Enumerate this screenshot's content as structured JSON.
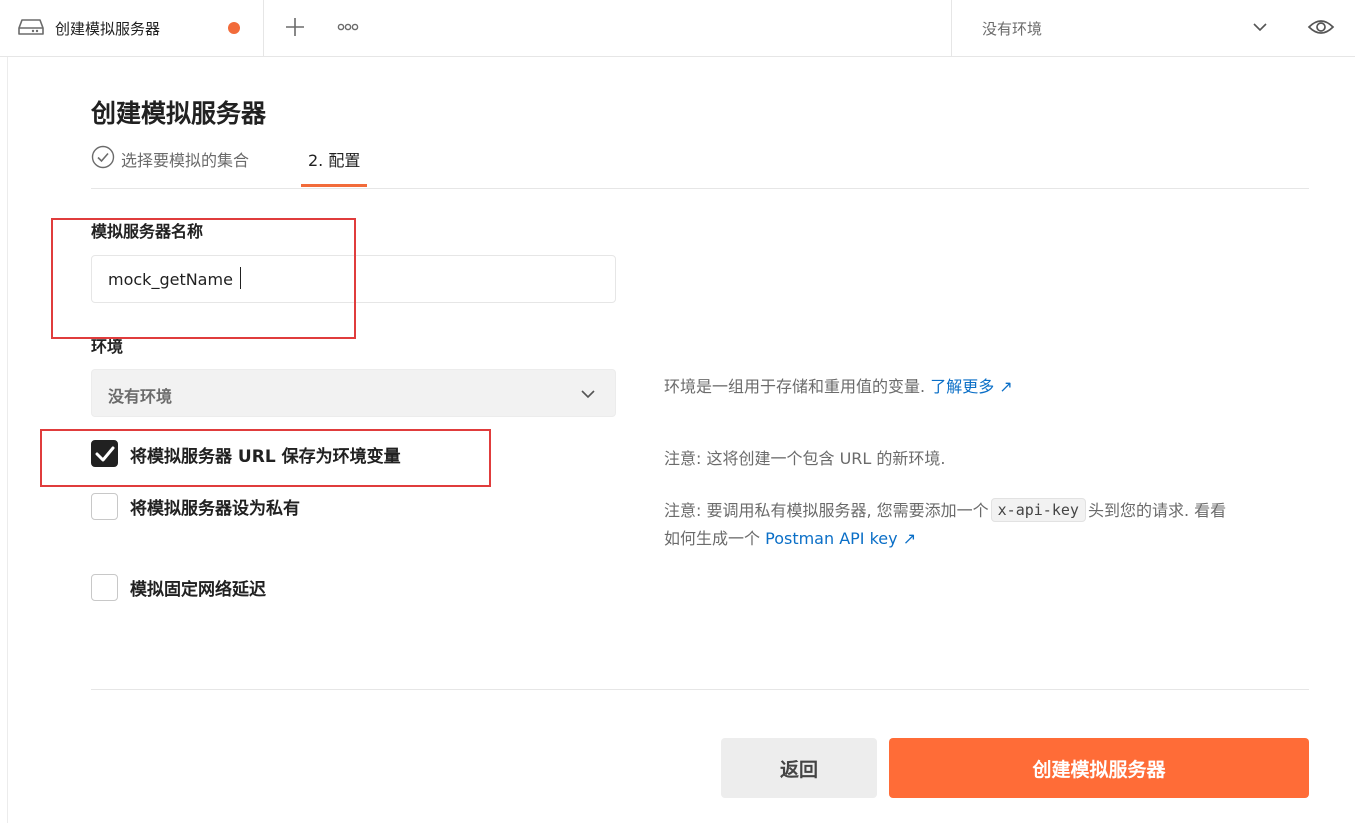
{
  "tab": {
    "title": "创建模拟服务器",
    "icon": "mock-server-icon",
    "unsaved_dot_color": "#f26b3a"
  },
  "toolbar": {
    "new_tab_icon": "plus-icon",
    "more_icon": "more-horizontal-icon",
    "environment_selector": "没有环境",
    "environment_quicklook_icon": "eye-icon"
  },
  "page": {
    "title": "创建模拟服务器",
    "steps": [
      {
        "label": "选择要模拟的集合",
        "state": "completed"
      },
      {
        "label": "2. 配置",
        "state": "active"
      }
    ]
  },
  "form": {
    "name_label": "模拟服务器名称",
    "name_value": "mock_getName",
    "environment_label": "环境",
    "environment_value": "没有环境",
    "environment_help": "环境是一组用于存储和重用值的变量.",
    "environment_help_link": "了解更多",
    "save_url_label": "将模拟服务器 URL 保存为环境变量",
    "save_url_checked": true,
    "save_url_note": "注意: 这将创建一个包含 URL 的新环境.",
    "private_label": "将模拟服务器设为私有",
    "private_checked": false,
    "private_note_part1": "注意: 要调用私有模拟服务器, 您需要添加一个",
    "private_note_code": "x-api-key",
    "private_note_part2": "头到您的请求. 看看",
    "private_note_line2": "如何生成一个",
    "private_note_link": "Postman API key",
    "delay_label": "模拟固定网络延迟",
    "delay_checked": false
  },
  "actions": {
    "back_label": "返回",
    "create_label": "创建模拟服务器",
    "primary_color": "#ff6c37"
  },
  "annotation_color": "#e03c3c"
}
